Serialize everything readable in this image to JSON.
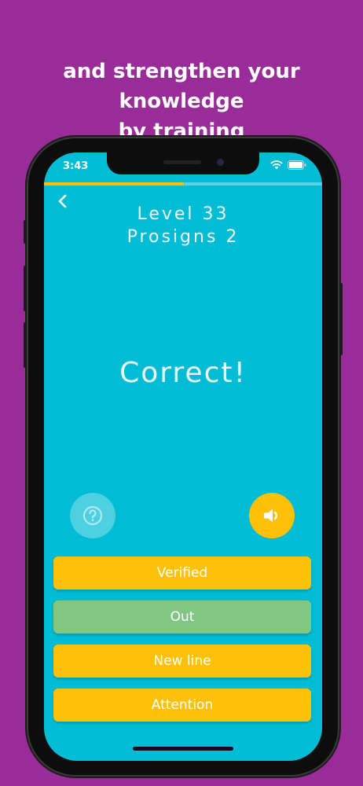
{
  "promo": {
    "line1": "and strengthen your knowledge",
    "line2": "by training"
  },
  "status_bar": {
    "time": "3:43"
  },
  "progress": {
    "fraction": 0.5
  },
  "quiz": {
    "level": "Level 33",
    "category": "Prosigns 2",
    "result": "Correct!"
  },
  "answers": [
    {
      "label": "Verified",
      "color": "#ffc107"
    },
    {
      "label": "Out",
      "color": "#81c784"
    },
    {
      "label": "New line",
      "color": "#ffc107"
    },
    {
      "label": "Attention",
      "color": "#ffc107"
    }
  ],
  "colors": {
    "background": "#9a2c9a",
    "screen": "#00bcd4",
    "accent": "#ffc107",
    "correct": "#81c784",
    "help_button": "#4dd0e1"
  },
  "icons": {
    "back": "chevron-left-icon",
    "help": "question-circle-icon",
    "sound": "speaker-icon"
  }
}
